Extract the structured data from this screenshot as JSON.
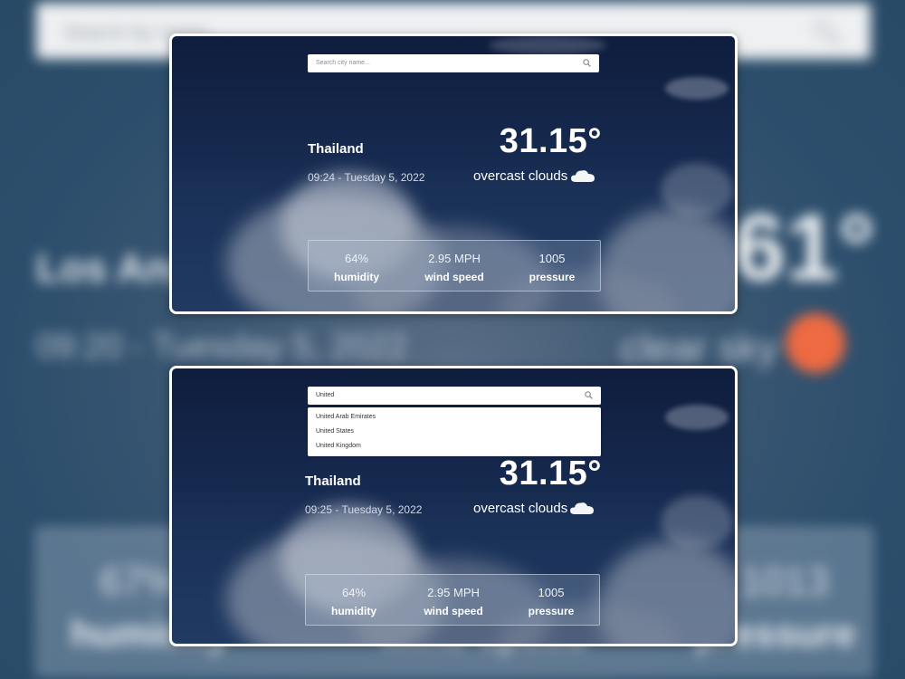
{
  "background": {
    "search_placeholder": "Search by name...",
    "city": "Los Angeles",
    "temperature": "61°",
    "time": "09:20 - Tuesday 5, 2022",
    "description": "clear sky",
    "weather_icon": "sun-icon",
    "stats": [
      {
        "value": "67%",
        "label": "humidity"
      },
      {
        "value": "",
        "label": "wind speed"
      },
      {
        "value": "1013",
        "label": "pressure"
      }
    ]
  },
  "screen1": {
    "search_placeholder": "Search city name...",
    "city": "Thailand",
    "time": "09:24 - Tuesday 5, 2022",
    "temperature": "31.15°",
    "description": "overcast clouds",
    "weather_icon": "cloud-icon",
    "stats": [
      {
        "value": "64%",
        "label": "humidity"
      },
      {
        "value": "2.95 MPH",
        "label": "wind speed"
      },
      {
        "value": "1005",
        "label": "pressure"
      }
    ]
  },
  "screen2": {
    "search_value": "United",
    "suggestions": [
      "United Arab Emirates",
      "United States",
      "United Kingdom"
    ],
    "city": "Thailand",
    "time": "09:25 - Tuesday 5, 2022",
    "temperature": "31.15°",
    "description": "overcast clouds",
    "weather_icon": "cloud-icon",
    "stats": [
      {
        "value": "64%",
        "label": "humidity"
      },
      {
        "value": "2.95 MPH",
        "label": "wind speed"
      },
      {
        "value": "1005",
        "label": "pressure"
      }
    ]
  },
  "colors": {
    "sky_top": "#0f1d3d",
    "sun": "#ee6a42",
    "panel_border": "#ffffff"
  }
}
